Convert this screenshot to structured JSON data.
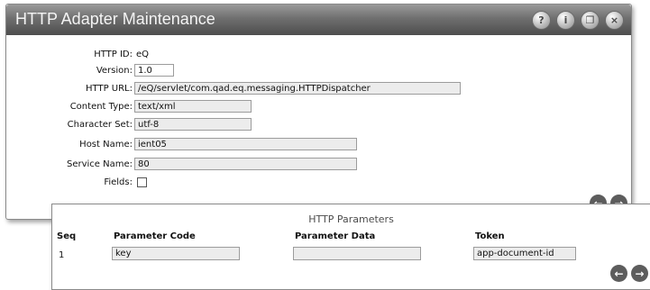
{
  "window": {
    "title": "HTTP Adapter Maintenance",
    "title_icons": [
      "help-icon",
      "info-icon",
      "restore-icon",
      "close-icon"
    ],
    "title_icon_glyphs": [
      "?",
      "i",
      "❐",
      "×"
    ]
  },
  "form": {
    "http_id": {
      "label": "HTTP ID:",
      "value": "eQ"
    },
    "version": {
      "label": "Version:",
      "value": "1.0"
    },
    "http_url": {
      "label": "HTTP URL:",
      "value": "/eQ/servlet/com.qad.eq.messaging.HTTPDispatcher"
    },
    "content_type": {
      "label": "Content Type:",
      "value": "text/xml"
    },
    "character_set": {
      "label": "Character Set:",
      "value": "utf-8"
    },
    "host_name": {
      "label": "Host Name:",
      "value": "ient05"
    },
    "service_name": {
      "label": "Service Name:",
      "value": "80"
    },
    "fields": {
      "label": "Fields:",
      "checked": false
    }
  },
  "nav": {
    "prev_glyph": "←",
    "next_glyph": "→"
  },
  "parameters": {
    "title": "HTTP Parameters",
    "columns": [
      "Seq",
      "Parameter Code",
      "Parameter Data",
      "Token"
    ],
    "rows": [
      {
        "seq": "1",
        "code": "key",
        "data": "",
        "token": "app-document-id"
      }
    ]
  },
  "colors": {
    "titlebar": "#5a5a5a",
    "field_bg": "#ececec",
    "nav_button": "#5d5d5d"
  }
}
